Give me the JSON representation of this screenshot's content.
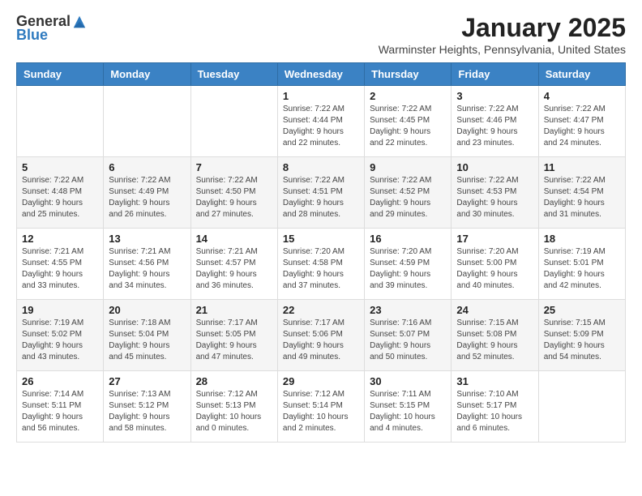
{
  "logo": {
    "general": "General",
    "blue": "Blue"
  },
  "title": "January 2025",
  "subtitle": "Warminster Heights, Pennsylvania, United States",
  "days_of_week": [
    "Sunday",
    "Monday",
    "Tuesday",
    "Wednesday",
    "Thursday",
    "Friday",
    "Saturday"
  ],
  "weeks": [
    [
      {
        "day": "",
        "info": ""
      },
      {
        "day": "",
        "info": ""
      },
      {
        "day": "",
        "info": ""
      },
      {
        "day": "1",
        "info": "Sunrise: 7:22 AM\nSunset: 4:44 PM\nDaylight: 9 hours\nand 22 minutes."
      },
      {
        "day": "2",
        "info": "Sunrise: 7:22 AM\nSunset: 4:45 PM\nDaylight: 9 hours\nand 22 minutes."
      },
      {
        "day": "3",
        "info": "Sunrise: 7:22 AM\nSunset: 4:46 PM\nDaylight: 9 hours\nand 23 minutes."
      },
      {
        "day": "4",
        "info": "Sunrise: 7:22 AM\nSunset: 4:47 PM\nDaylight: 9 hours\nand 24 minutes."
      }
    ],
    [
      {
        "day": "5",
        "info": "Sunrise: 7:22 AM\nSunset: 4:48 PM\nDaylight: 9 hours\nand 25 minutes."
      },
      {
        "day": "6",
        "info": "Sunrise: 7:22 AM\nSunset: 4:49 PM\nDaylight: 9 hours\nand 26 minutes."
      },
      {
        "day": "7",
        "info": "Sunrise: 7:22 AM\nSunset: 4:50 PM\nDaylight: 9 hours\nand 27 minutes."
      },
      {
        "day": "8",
        "info": "Sunrise: 7:22 AM\nSunset: 4:51 PM\nDaylight: 9 hours\nand 28 minutes."
      },
      {
        "day": "9",
        "info": "Sunrise: 7:22 AM\nSunset: 4:52 PM\nDaylight: 9 hours\nand 29 minutes."
      },
      {
        "day": "10",
        "info": "Sunrise: 7:22 AM\nSunset: 4:53 PM\nDaylight: 9 hours\nand 30 minutes."
      },
      {
        "day": "11",
        "info": "Sunrise: 7:22 AM\nSunset: 4:54 PM\nDaylight: 9 hours\nand 31 minutes."
      }
    ],
    [
      {
        "day": "12",
        "info": "Sunrise: 7:21 AM\nSunset: 4:55 PM\nDaylight: 9 hours\nand 33 minutes."
      },
      {
        "day": "13",
        "info": "Sunrise: 7:21 AM\nSunset: 4:56 PM\nDaylight: 9 hours\nand 34 minutes."
      },
      {
        "day": "14",
        "info": "Sunrise: 7:21 AM\nSunset: 4:57 PM\nDaylight: 9 hours\nand 36 minutes."
      },
      {
        "day": "15",
        "info": "Sunrise: 7:20 AM\nSunset: 4:58 PM\nDaylight: 9 hours\nand 37 minutes."
      },
      {
        "day": "16",
        "info": "Sunrise: 7:20 AM\nSunset: 4:59 PM\nDaylight: 9 hours\nand 39 minutes."
      },
      {
        "day": "17",
        "info": "Sunrise: 7:20 AM\nSunset: 5:00 PM\nDaylight: 9 hours\nand 40 minutes."
      },
      {
        "day": "18",
        "info": "Sunrise: 7:19 AM\nSunset: 5:01 PM\nDaylight: 9 hours\nand 42 minutes."
      }
    ],
    [
      {
        "day": "19",
        "info": "Sunrise: 7:19 AM\nSunset: 5:02 PM\nDaylight: 9 hours\nand 43 minutes."
      },
      {
        "day": "20",
        "info": "Sunrise: 7:18 AM\nSunset: 5:04 PM\nDaylight: 9 hours\nand 45 minutes."
      },
      {
        "day": "21",
        "info": "Sunrise: 7:17 AM\nSunset: 5:05 PM\nDaylight: 9 hours\nand 47 minutes."
      },
      {
        "day": "22",
        "info": "Sunrise: 7:17 AM\nSunset: 5:06 PM\nDaylight: 9 hours\nand 49 minutes."
      },
      {
        "day": "23",
        "info": "Sunrise: 7:16 AM\nSunset: 5:07 PM\nDaylight: 9 hours\nand 50 minutes."
      },
      {
        "day": "24",
        "info": "Sunrise: 7:15 AM\nSunset: 5:08 PM\nDaylight: 9 hours\nand 52 minutes."
      },
      {
        "day": "25",
        "info": "Sunrise: 7:15 AM\nSunset: 5:09 PM\nDaylight: 9 hours\nand 54 minutes."
      }
    ],
    [
      {
        "day": "26",
        "info": "Sunrise: 7:14 AM\nSunset: 5:11 PM\nDaylight: 9 hours\nand 56 minutes."
      },
      {
        "day": "27",
        "info": "Sunrise: 7:13 AM\nSunset: 5:12 PM\nDaylight: 9 hours\nand 58 minutes."
      },
      {
        "day": "28",
        "info": "Sunrise: 7:12 AM\nSunset: 5:13 PM\nDaylight: 10 hours\nand 0 minutes."
      },
      {
        "day": "29",
        "info": "Sunrise: 7:12 AM\nSunset: 5:14 PM\nDaylight: 10 hours\nand 2 minutes."
      },
      {
        "day": "30",
        "info": "Sunrise: 7:11 AM\nSunset: 5:15 PM\nDaylight: 10 hours\nand 4 minutes."
      },
      {
        "day": "31",
        "info": "Sunrise: 7:10 AM\nSunset: 5:17 PM\nDaylight: 10 hours\nand 6 minutes."
      },
      {
        "day": "",
        "info": ""
      }
    ]
  ]
}
